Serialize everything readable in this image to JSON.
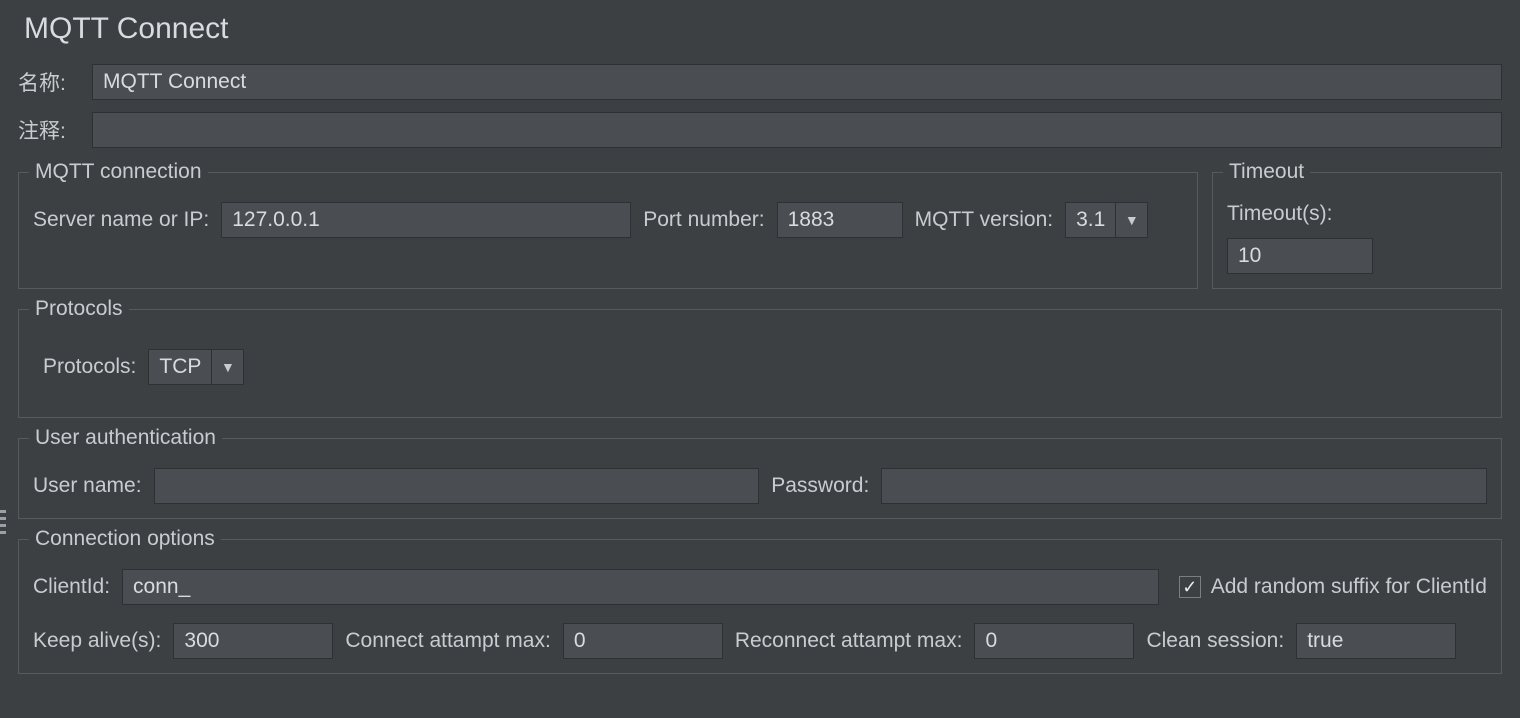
{
  "title": "MQTT Connect",
  "labels": {
    "name": "名称:",
    "comment": "注释:",
    "mqtt_connection": "MQTT connection",
    "server": "Server name or IP:",
    "port": "Port number:",
    "version": "MQTT version:",
    "timeout_group": "Timeout",
    "timeout": "Timeout(s):",
    "protocols_group": "Protocols",
    "protocols": "Protocols:",
    "auth_group": "User authentication",
    "username": "User name:",
    "password": "Password:",
    "conn_opts_group": "Connection options",
    "clientid": "ClientId:",
    "add_suffix": "Add random suffix for ClientId",
    "keepalive": "Keep alive(s):",
    "conn_attempt": "Connect attampt max:",
    "reconn_attempt": "Reconnect attampt max:",
    "clean_session": "Clean session:"
  },
  "values": {
    "name": "MQTT Connect",
    "comment": "",
    "server": "127.0.0.1",
    "port": "1883",
    "version": "3.1",
    "timeout": "10",
    "protocol": "TCP",
    "username": "",
    "password": "",
    "clientid": "conn_",
    "add_suffix_checked": true,
    "keepalive": "300",
    "conn_attempt": "0",
    "reconn_attempt": "0",
    "clean_session": "true"
  }
}
